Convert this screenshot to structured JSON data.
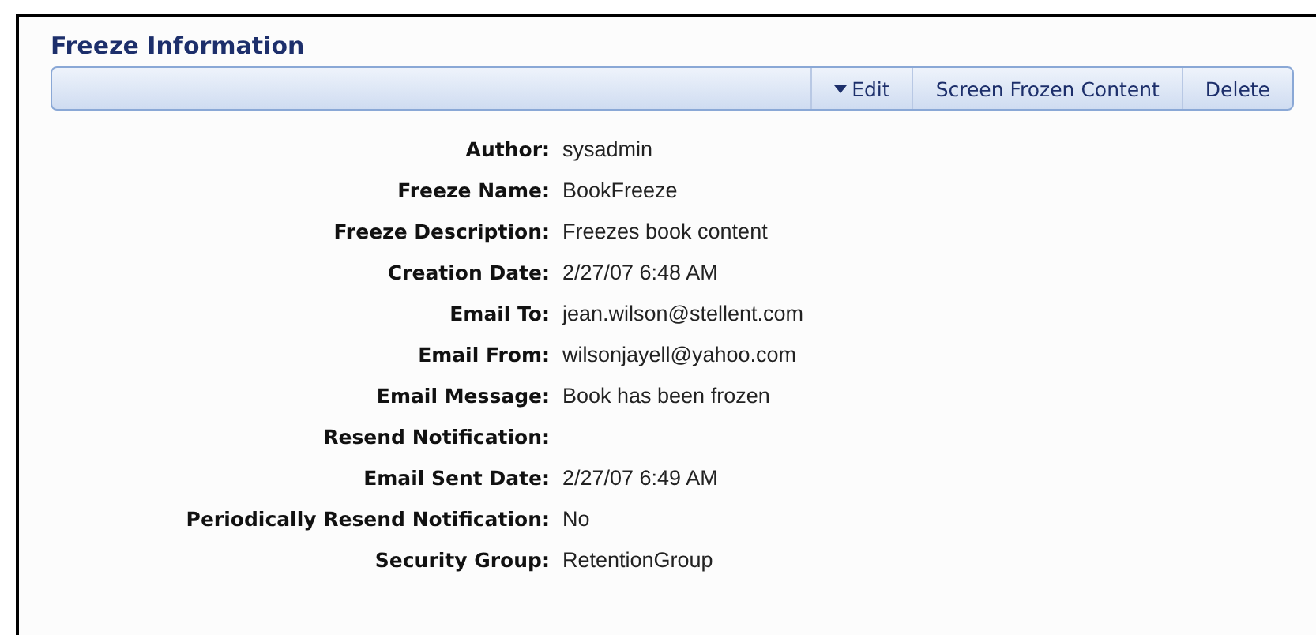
{
  "panel": {
    "title": "Freeze Information"
  },
  "toolbar": [
    {
      "label": "Edit",
      "has_menu": true
    },
    {
      "label": "Screen Frozen Content",
      "has_menu": false
    },
    {
      "label": "Delete",
      "has_menu": false
    }
  ],
  "fields": [
    {
      "label": "Author:",
      "value": "sysadmin"
    },
    {
      "label": "Freeze Name:",
      "value": "BookFreeze"
    },
    {
      "label": "Freeze Description:",
      "value": "Freezes book content"
    },
    {
      "label": "Creation Date:",
      "value": "2/27/07 6:48 AM"
    },
    {
      "label": "Email To:",
      "value": "jean.wilson@stellent.com"
    },
    {
      "label": "Email From:",
      "value": "wilsonjayell@yahoo.com"
    },
    {
      "label": "Email Message:",
      "value": "Book has been frozen"
    },
    {
      "label": "Resend Notification:"
    },
    {
      "label": "Email Sent Date:",
      "value": "2/27/07 6:49 AM"
    },
    {
      "label": "Periodically Resend Notification:",
      "value": "No"
    },
    {
      "label": "Security Group:",
      "value": "RetentionGroup"
    }
  ]
}
